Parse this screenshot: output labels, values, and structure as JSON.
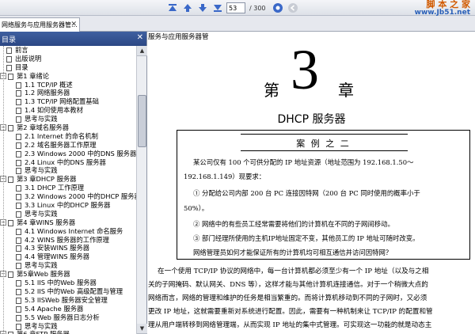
{
  "toolbar": {
    "page_current": "53",
    "page_total": "/ 300",
    "icons": [
      "first-page-icon",
      "prev-page-icon",
      "next-page-icon",
      "last-page-icon",
      "go-icon",
      "back-icon"
    ]
  },
  "watermark": {
    "line1": "脚 本 之 家",
    "line2": "www.Jb51.net"
  },
  "tab": {
    "title": "网络服务与应用服务器管..."
  },
  "sidebar": {
    "header": "目录",
    "items": [
      {
        "label": "前言"
      },
      {
        "label": "出版说明"
      },
      {
        "label": "目录"
      },
      {
        "label": "第1 章绪论"
      },
      {
        "label": "1.1 TCP/IP 概述"
      },
      {
        "label": "1.2 网络服务器"
      },
      {
        "label": "1.3 TCP/IP 网络配置基础"
      },
      {
        "label": "1.4 如何使用本教材"
      },
      {
        "label": "思考与实践"
      },
      {
        "label": "第2 章域名服务器"
      },
      {
        "label": "2.1 Internet 的命名机制"
      },
      {
        "label": "2.2 域名服务器工作原理"
      },
      {
        "label": "2.3 Windows 2000 中的DNS 服务器"
      },
      {
        "label": "2.4 Linux 中的DNS 服务器"
      },
      {
        "label": "思考与实践"
      },
      {
        "label": "第3 章DHCP 服务器"
      },
      {
        "label": "3.1 DHCP 工作原理"
      },
      {
        "label": "3.2 Windows 2000 中的DHCP 服务器"
      },
      {
        "label": "3.3 Linux 中的DHCP 服务器"
      },
      {
        "label": "思考与实践"
      },
      {
        "label": "第4 章WINS 服务器"
      },
      {
        "label": "4.1 Windows Internet 命名服务"
      },
      {
        "label": "4.2 WINS 服务器的工作原理"
      },
      {
        "label": "4.3 安装WINS 服务器"
      },
      {
        "label": "4.4 管理WINS 服务器"
      },
      {
        "label": "思考与实践"
      },
      {
        "label": "第5章Web 服务器"
      },
      {
        "label": "5.1 IIS 中的Web 服务器"
      },
      {
        "label": "5.2 IIS 中的Web 高级配置与管理"
      },
      {
        "label": "5.3 IISWeb 服务器安全管理"
      },
      {
        "label": "5.4 Apache 服务器"
      },
      {
        "label": "5.5 Web 服务器日志分析"
      },
      {
        "label": "思考与实践"
      },
      {
        "label": "第6 章FTP 服务器"
      }
    ]
  },
  "document": {
    "left_header": "服务与应用服务器管",
    "chapter_prefix": "第",
    "chapter_number": "3",
    "chapter_suffix": "章",
    "chapter_title": "DHCP 服务器",
    "case": {
      "title": "案 例 之 二",
      "lines": [
        "某公司仅有 100 个可供分配的 IP 地址资源（地址范围为 192.168.1.50～",
        "192.168.1.149）现要求：",
        "①  分配给公司内部 200 台 PC 连接因特网（200 台 PC 同时使用的概率小于",
        "50%）。",
        "②  网络中的有些员工经常需要将他们的计算机在不同的子网间移动。",
        "③  部门经理所使用的主机IP地址固定不变，其他员工的 IP 地址可随时改变。",
        "网络管理员如何才能保证所有的计算机均可相互通信并访问因特网？"
      ]
    },
    "body": [
      "在一个使用 TCP/IP 协议的网络中，每一台计算机都必须至少有一个 IP 地址（以及与之相",
      "关的子网掩码、默认网关、DNS 等），这样才能与其他计算机连接通信。对于一个稍微大点的",
      "网络而言，网络的管理和维护的任务是相当繁重的。而将计算机移动到不同的子网时，又必须",
      "更改 IP 地址，这就需要重新对系统进行配置。因此，需要有一种机制来让 TCP/IP 的配置和管",
      "理从用户端转移到网络管理端，从而实现 IP 地址的集中式管理。可实现这一功能的就是动态主"
    ]
  }
}
